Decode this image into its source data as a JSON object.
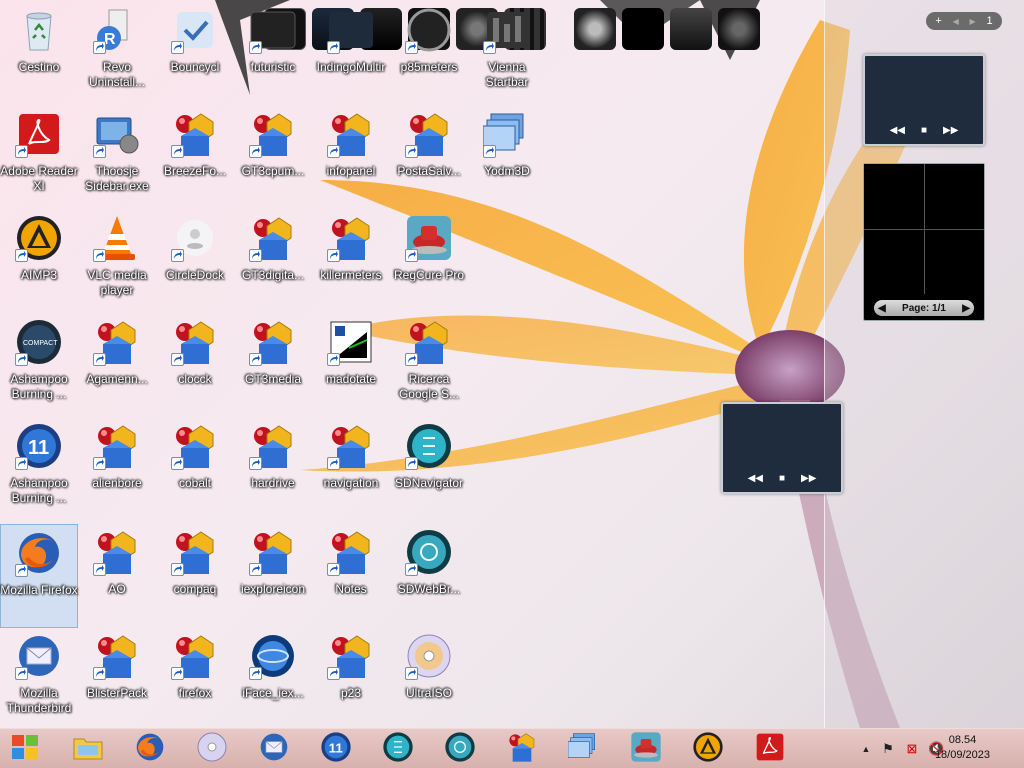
{
  "desktop": {
    "icons": [
      {
        "label": "Cestino",
        "icon": "recycle-bin-icon"
      },
      {
        "label": "Revo Uninstall...",
        "icon": "revo-uninstaller-icon"
      },
      {
        "label": "Bouncycl",
        "icon": "bouncycl-icon"
      },
      {
        "label": "futuristic",
        "icon": "futuristic-icon"
      },
      {
        "label": "IndingoMultir",
        "icon": "indigo-multir-icon"
      },
      {
        "label": "p85meters",
        "icon": "p85meters-icon"
      },
      {
        "label": "Vienna Startbar",
        "icon": "vienna-startbar-icon"
      },
      {
        "label": "Adobe Reader XI",
        "icon": "adobe-reader-icon"
      },
      {
        "label": "Thoosje Sidebar.exe",
        "icon": "thoosje-sidebar-icon"
      },
      {
        "label": "BreezeFo...",
        "icon": "rainmeter-skin-icon"
      },
      {
        "label": "GT3cpum...",
        "icon": "rainmeter-skin-icon"
      },
      {
        "label": "infopanel",
        "icon": "rainmeter-skin-icon"
      },
      {
        "label": "PostaSalv...",
        "icon": "rainmeter-skin-icon"
      },
      {
        "label": "Yodm3D",
        "icon": "yodm3d-icon"
      },
      {
        "label": "AIMP3",
        "icon": "aimp-icon"
      },
      {
        "label": "VLC media player",
        "icon": "vlc-icon"
      },
      {
        "label": "CircleDock",
        "icon": "circledock-icon"
      },
      {
        "label": "GT3digita...",
        "icon": "rainmeter-skin-icon"
      },
      {
        "label": "killermeters",
        "icon": "rainmeter-skin-icon"
      },
      {
        "label": "RegCure Pro",
        "icon": "regcure-icon"
      },
      {
        "label": "Ashampoo Burning ...",
        "icon": "ashampoo-compact-icon"
      },
      {
        "label": "Agamenn...",
        "icon": "rainmeter-skin-icon"
      },
      {
        "label": "clocck",
        "icon": "rainmeter-skin-icon"
      },
      {
        "label": "GT3media",
        "icon": "rainmeter-skin-icon"
      },
      {
        "label": "madotate",
        "icon": "madotate-icon"
      },
      {
        "label": "Ricerca Google S...",
        "icon": "rainmeter-skin-icon"
      },
      {
        "label": "Ashampoo Burning ...",
        "icon": "ashampoo-11-icon"
      },
      {
        "label": "alienbore",
        "icon": "rainmeter-skin-icon"
      },
      {
        "label": "cobalt",
        "icon": "rainmeter-skin-icon"
      },
      {
        "label": "hardrive",
        "icon": "rainmeter-skin-icon"
      },
      {
        "label": "navigation",
        "icon": "rainmeter-skin-icon"
      },
      {
        "label": "SDNavigator",
        "icon": "sdnavigator-icon"
      },
      {
        "label": "Mozilla Firefox",
        "icon": "firefox-icon"
      },
      {
        "label": "AO",
        "icon": "rainmeter-skin-icon"
      },
      {
        "label": "compaq",
        "icon": "rainmeter-skin-icon"
      },
      {
        "label": "iexploreicon",
        "icon": "rainmeter-skin-icon"
      },
      {
        "label": "Notes",
        "icon": "rainmeter-skin-icon"
      },
      {
        "label": "SDWebBr...",
        "icon": "sdwebbrowser-icon"
      },
      {
        "label": "Mozilla Thunderbird",
        "icon": "thunderbird-icon"
      },
      {
        "label": "BlisterPack",
        "icon": "rainmeter-skin-icon"
      },
      {
        "label": "firefox",
        "icon": "rainmeter-skin-icon"
      },
      {
        "label": "iFace_iex...",
        "icon": "iface-icon"
      },
      {
        "label": "p23",
        "icon": "rainmeter-skin-icon"
      },
      {
        "label": "UltraISO",
        "icon": "ultraiso-icon"
      }
    ]
  },
  "gadgets": {
    "pager": {
      "add": "+",
      "prev": "◀",
      "next": "▶",
      "page": "1"
    },
    "media_controls": {
      "rewind": "◀◀",
      "stop": "■",
      "forward": "▶▶"
    },
    "slideshow": {
      "page_label": "Page: 1/1",
      "prev": "◀",
      "next": "▶"
    }
  },
  "taskbar": {
    "items": [
      {
        "name": "start-orb-icon"
      },
      {
        "name": "file-explorer-icon"
      },
      {
        "name": "firefox-icon"
      },
      {
        "name": "cd-disc-icon"
      },
      {
        "name": "thunderbird-icon"
      },
      {
        "name": "ashampoo-11-icon"
      },
      {
        "name": "sdnavigator-icon"
      },
      {
        "name": "sdwebbrowser-icon"
      },
      {
        "name": "rainmeter-skin-icon"
      },
      {
        "name": "yodm3d-icon"
      },
      {
        "name": "regcure-icon"
      },
      {
        "name": "aimp-icon"
      },
      {
        "name": "adobe-reader-icon"
      }
    ],
    "tray": {
      "show_hidden": "▲",
      "flag": "⚑",
      "network": "⊠",
      "volume": "🔇"
    },
    "clock": {
      "time": "08.54",
      "date": "18/09/2023"
    }
  }
}
